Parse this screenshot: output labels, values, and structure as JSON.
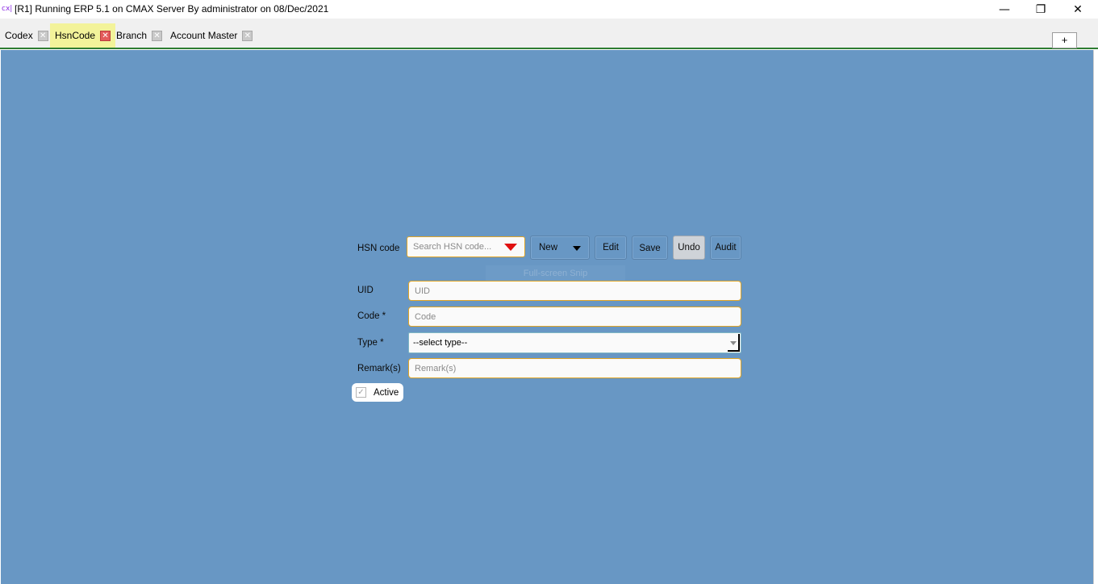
{
  "window": {
    "app_icon": "cx|",
    "title": "[R1] Running ERP 5.1 on CMAX Server By administrator on 08/Dec/2021",
    "minimize_glyph": "—",
    "restore_glyph": "❐",
    "close_glyph": "✕"
  },
  "tabs": [
    {
      "label": "Codex",
      "active": false
    },
    {
      "label": "HsnCode",
      "active": true
    },
    {
      "label": "Branch",
      "active": false
    },
    {
      "label": "Account Master",
      "active": false
    }
  ],
  "tab_close_glyph": "✕",
  "add_tab_label": "+",
  "form": {
    "hsn_label": "HSN code",
    "search_placeholder": "Search HSN code...",
    "buttons": {
      "new": "New",
      "edit": "Edit",
      "save": "Save",
      "undo": "Undo",
      "audit": "Audit"
    },
    "ghost_text": "Full-screen Snip",
    "uid_label": "UID",
    "uid_placeholder": "UID",
    "code_label": "Code *",
    "code_placeholder": "Code",
    "type_label": "Type *",
    "type_value": "--select type--",
    "remarks_label": "Remark(s)",
    "remarks_placeholder": "Remark(s)",
    "active_label": "Active",
    "active_checked": true,
    "check_glyph": "✓"
  },
  "colors": {
    "canvas": "#6897c4",
    "active_tab": "#f3f39a",
    "field_border": "#e0a526",
    "search_arrow": "#e01010",
    "tab_underline": "#2e7d32"
  }
}
